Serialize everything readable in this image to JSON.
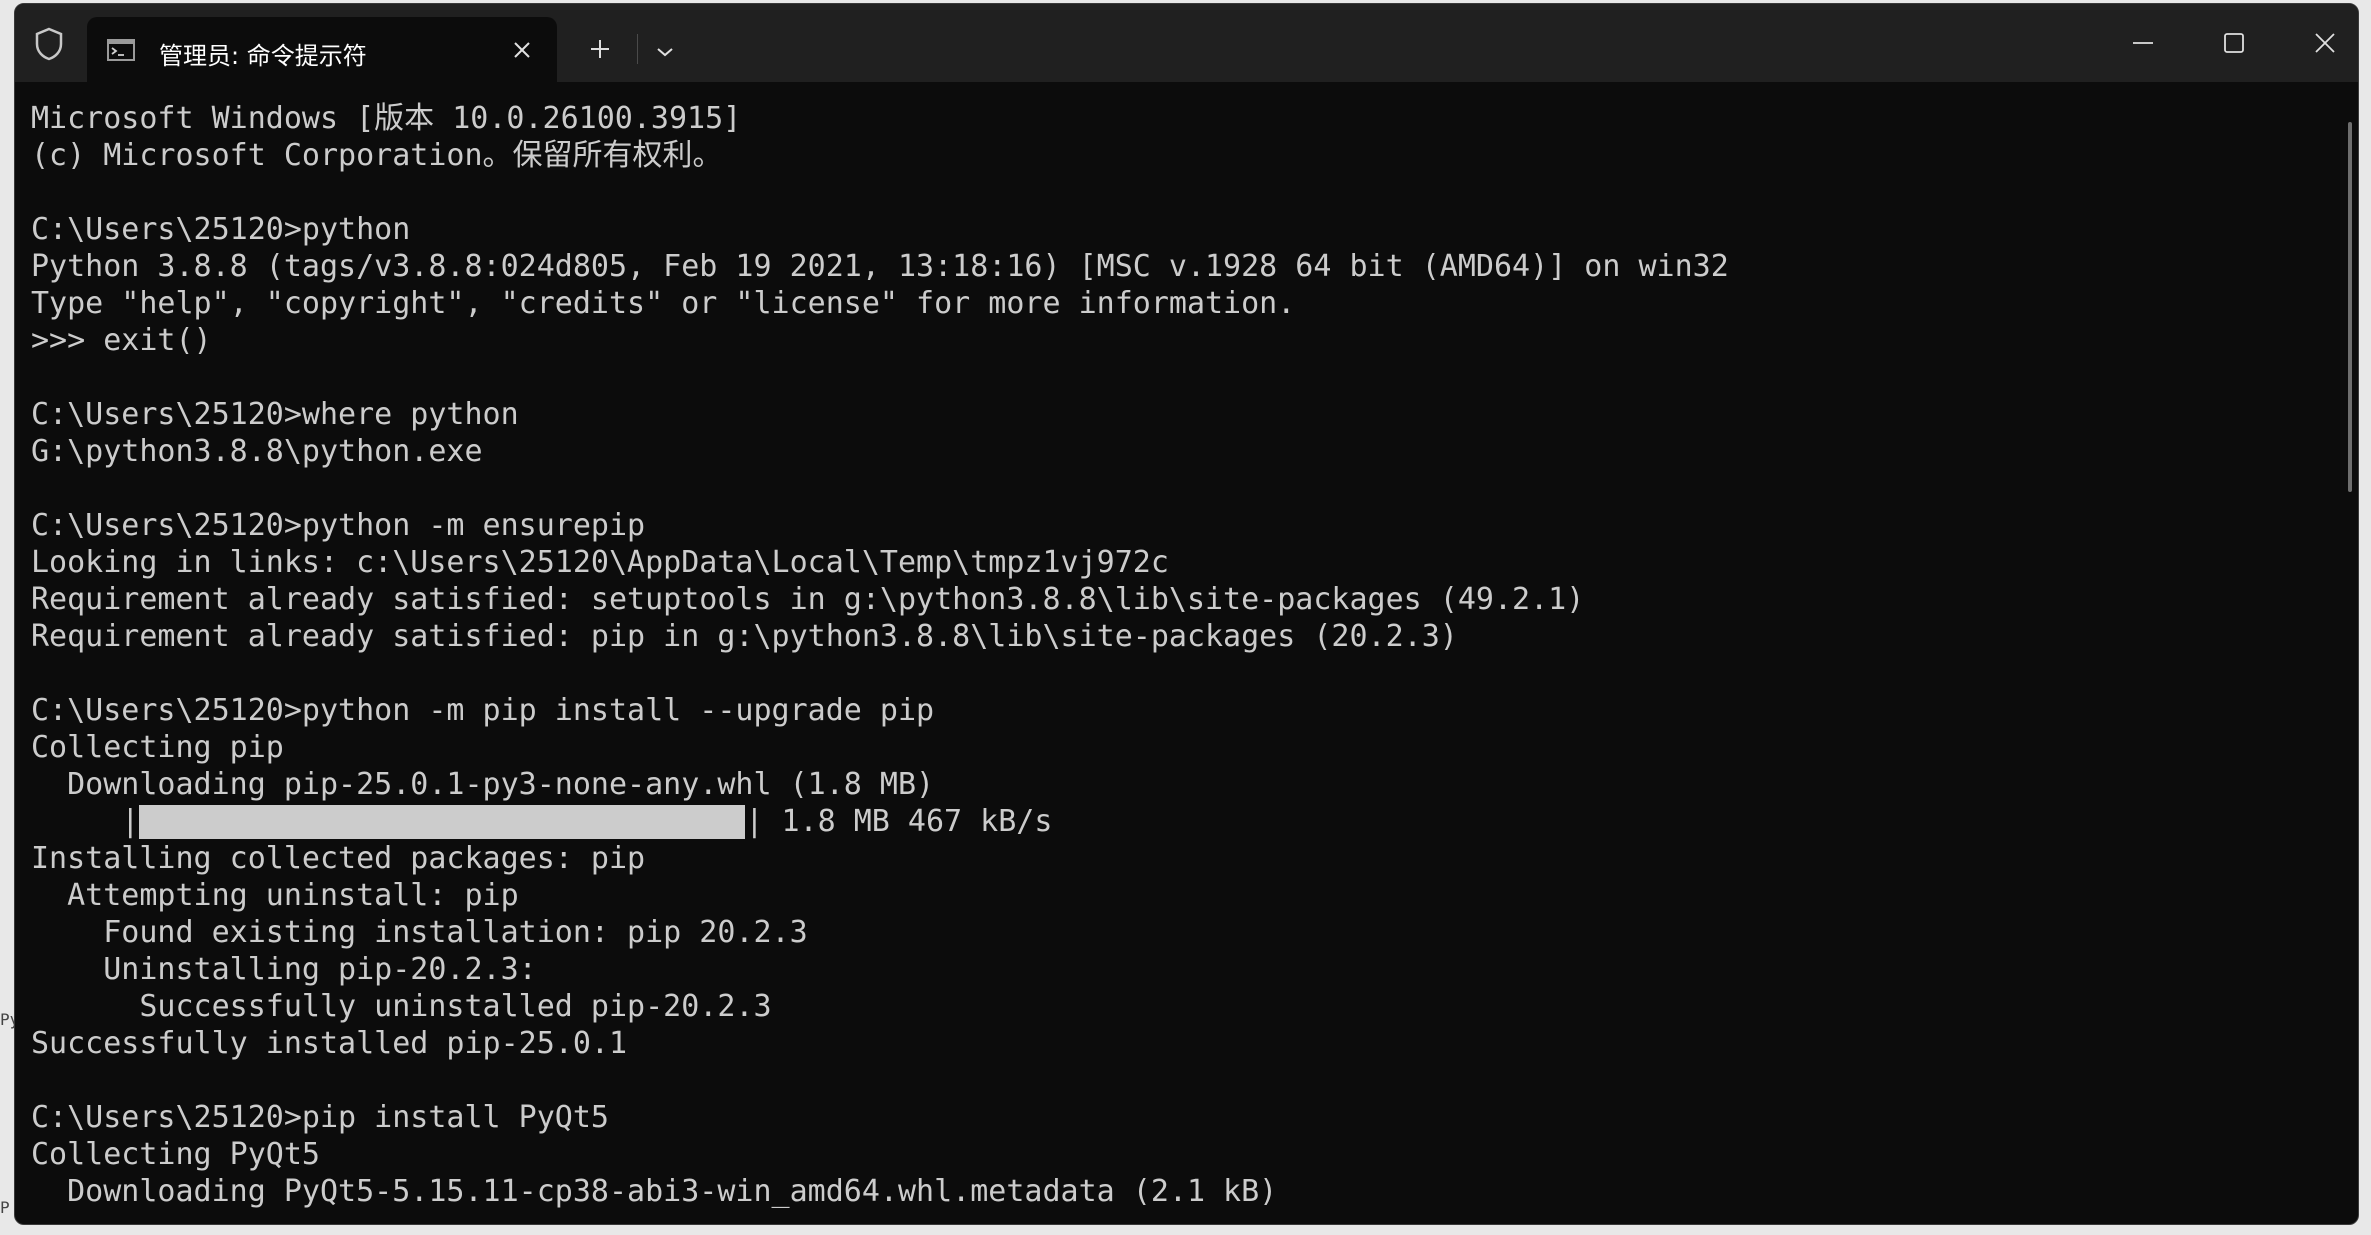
{
  "background": {
    "strip_text_1": "Py",
    "strip_text_2": "P"
  },
  "tab": {
    "title": "管理员: 命令提示符",
    "icon": "cmd-icon"
  },
  "titlebar": {
    "icons": [
      "shield-icon",
      "close-icon",
      "plus-icon",
      "chevron-down-icon",
      "minimize-icon",
      "maximize-icon",
      "close-icon"
    ]
  },
  "colors": {
    "terminal_bg": "#0c0c0c",
    "terminal_fg": "#cccccc",
    "titlebar_bg": "#202020"
  },
  "terminal": {
    "lines": [
      "Microsoft Windows [版本 10.0.26100.3915]",
      "(c) Microsoft Corporation。保留所有权利。",
      "",
      "C:\\Users\\25120>python",
      "Python 3.8.8 (tags/v3.8.8:024d805, Feb 19 2021, 13:18:16) [MSC v.1928 64 bit (AMD64)] on win32",
      "Type \"help\", \"copyright\", \"credits\" or \"license\" for more information.",
      ">>> exit()",
      "",
      "C:\\Users\\25120>where python",
      "G:\\python3.8.8\\python.exe",
      "",
      "C:\\Users\\25120>python -m ensurepip",
      "Looking in links: c:\\Users\\25120\\AppData\\Local\\Temp\\tmpz1vj972c",
      "Requirement already satisfied: setuptools in g:\\python3.8.8\\lib\\site-packages (49.2.1)",
      "Requirement already satisfied: pip in g:\\python3.8.8\\lib\\site-packages (20.2.3)",
      "",
      "C:\\Users\\25120>python -m pip install --upgrade pip",
      "Collecting pip",
      "  Downloading pip-25.0.1-py3-none-any.whl (1.8 MB)"
    ],
    "progress": {
      "prefix": "     |",
      "suffix": "| 1.8 MB 467 kB/s",
      "fraction": 1.0
    },
    "lines_after": [
      "Installing collected packages: pip",
      "  Attempting uninstall: pip",
      "    Found existing installation: pip 20.2.3",
      "    Uninstalling pip-20.2.3:",
      "      Successfully uninstalled pip-20.2.3",
      "Successfully installed pip-25.0.1",
      "",
      "C:\\Users\\25120>pip install PyQt5",
      "Collecting PyQt5",
      "  Downloading PyQt5-5.15.11-cp38-abi3-win_amd64.whl.metadata (2.1 kB)"
    ]
  }
}
